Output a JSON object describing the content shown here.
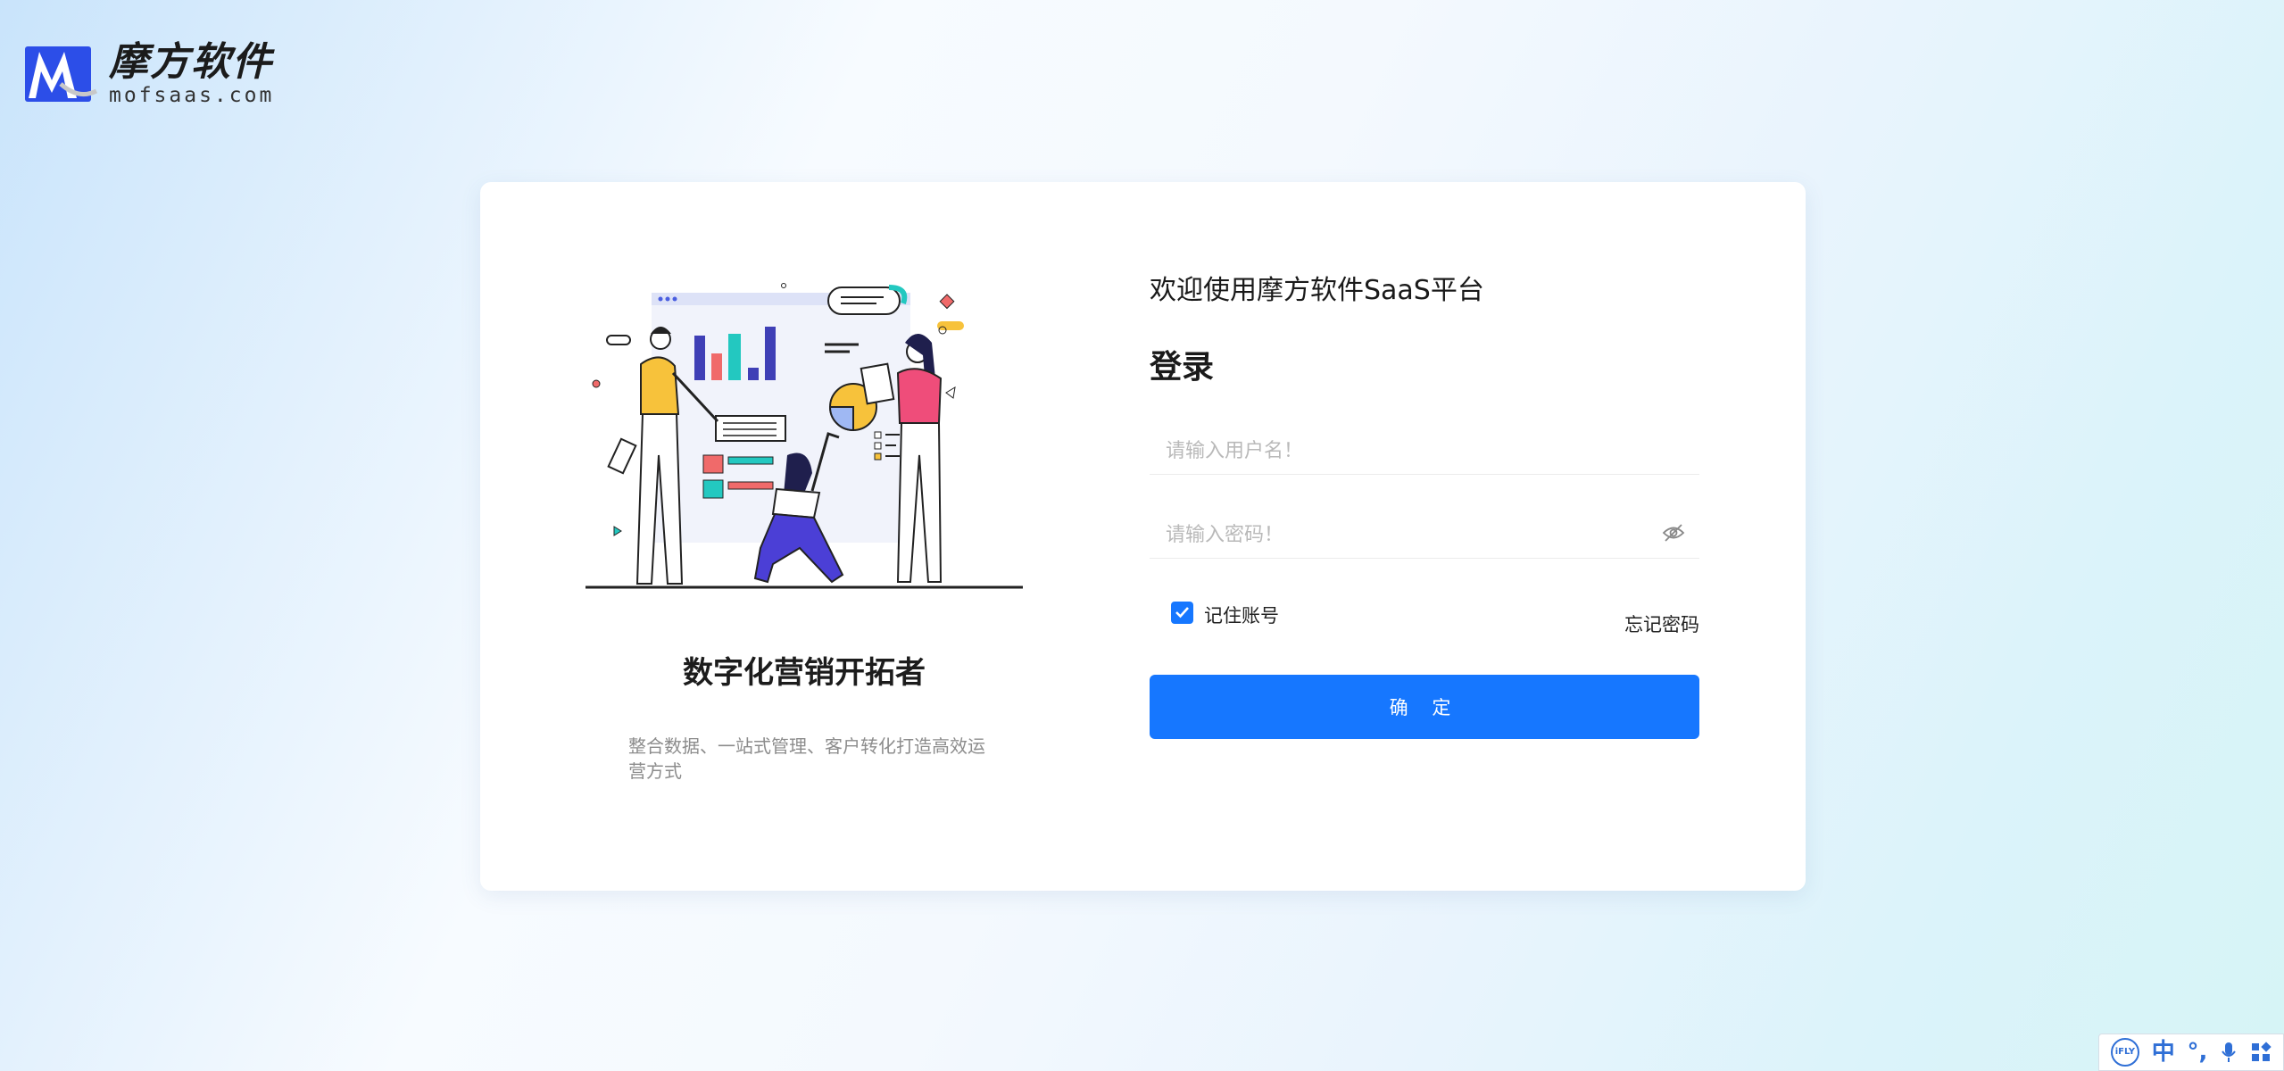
{
  "brand": {
    "name_cn": "摩方软件",
    "domain": "mofsaas.com",
    "accent": "#1677ff"
  },
  "intro": {
    "slogan": "数字化营销开拓者",
    "description": "整合数据、一站式管理、客户转化打造高效运营方式"
  },
  "login": {
    "welcome": "欢迎使用摩方软件SaaS平台",
    "title": "登录",
    "username_placeholder": "请输入用户名！",
    "password_placeholder": "请输入密码！",
    "remember_label": "记住账号",
    "remember_checked": true,
    "forgot_label": "忘记密码",
    "submit_label": "确 定"
  },
  "ime_toolbar": {
    "badge": "iFLY",
    "lang": "中",
    "punct": "°,",
    "mic_icon": "microphone-icon",
    "apps_icon": "grid-apps-icon"
  }
}
